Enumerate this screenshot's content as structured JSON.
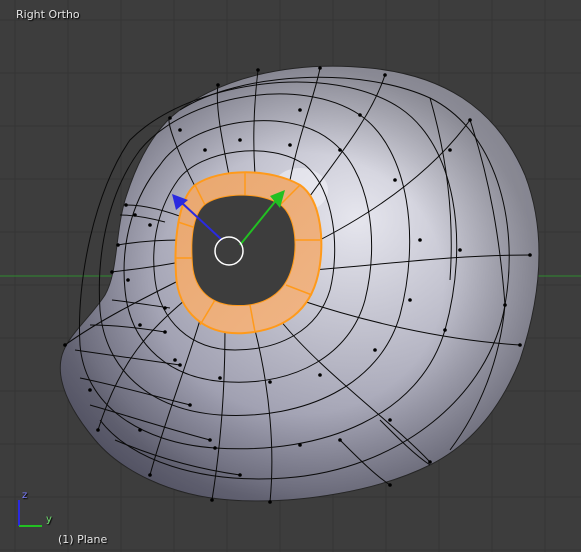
{
  "viewport": {
    "view_name": "Right Ortho",
    "object_name": "(1) Plane",
    "background_color": "#3d3d3d",
    "grid_color": "#353535",
    "horizon_line_color": "#2e8b2e"
  },
  "mesh": {
    "surface_color": "#a8a8b8",
    "edge_color": "#0a0a0a",
    "selected_face_color": "#e8a670",
    "selected_edge_color": "#ff9a1a"
  },
  "gizmo": {
    "transform_y_color": "#22c022",
    "transform_z_color": "#2a2ae0",
    "axis_labels": {
      "z": "z",
      "y": "y"
    }
  },
  "icons": [
    "pivot-circle-icon",
    "transform-arrow-y-icon",
    "transform-arrow-z-icon",
    "axis-gizmo-icon"
  ]
}
